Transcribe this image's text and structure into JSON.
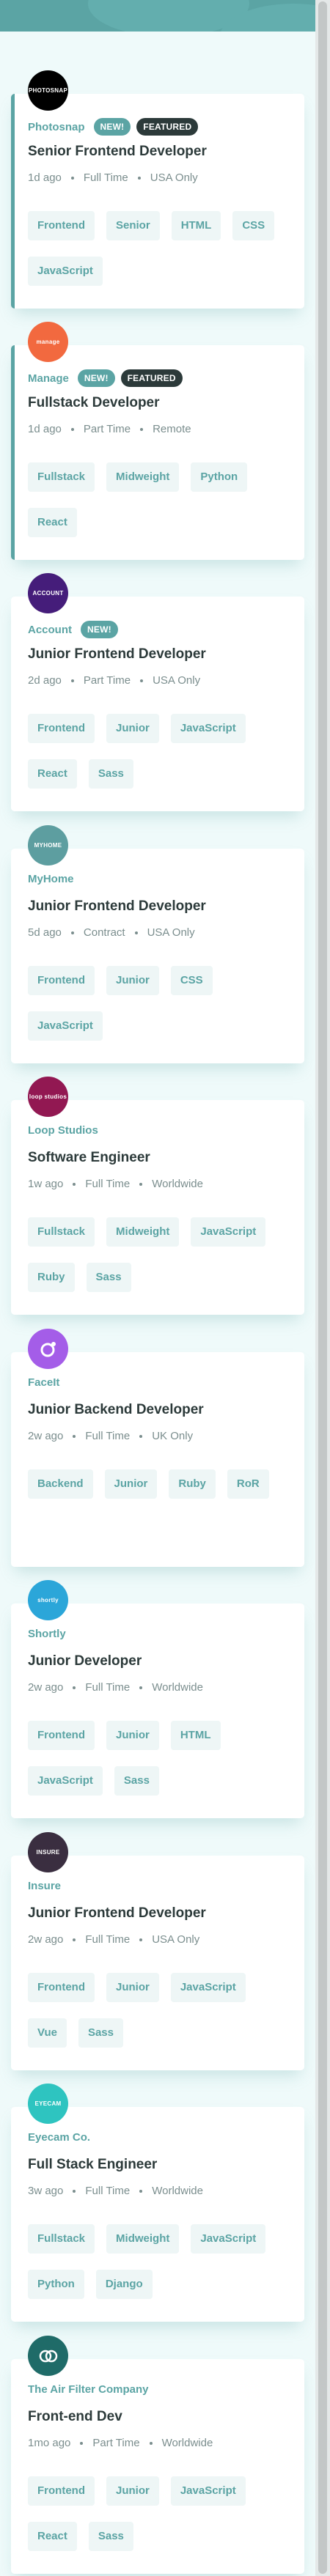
{
  "colors": {
    "accent": "#5ba4a4",
    "dark": "#2c3a3a",
    "muted": "#7b8e8e",
    "tag_bg": "#eef6f6",
    "background": "#effafa"
  },
  "badges": {
    "new": "NEW!",
    "featured": "FEATURED"
  },
  "jobs": [
    {
      "company": "Photosnap",
      "logo_text": "PHOTOSNAP",
      "logo_color": "#000000",
      "logo_icon": "photosnap-logo-icon",
      "new": true,
      "featured": true,
      "position": "Senior Frontend Developer",
      "posted": "1d ago",
      "contract": "Full Time",
      "location": "USA Only",
      "tags": [
        "Frontend",
        "Senior",
        "HTML",
        "CSS",
        "JavaScript"
      ]
    },
    {
      "company": "Manage",
      "logo_text": "manage",
      "logo_color": "#f2693f",
      "logo_icon": "manage-logo-icon",
      "new": true,
      "featured": true,
      "position": "Fullstack Developer",
      "posted": "1d ago",
      "contract": "Part Time",
      "location": "Remote",
      "tags": [
        "Fullstack",
        "Midweight",
        "Python",
        "React"
      ]
    },
    {
      "company": "Account",
      "logo_text": "ACCOUNT",
      "logo_color": "#451d7a",
      "logo_icon": "account-logo-icon",
      "new": true,
      "featured": false,
      "position": "Junior Frontend Developer",
      "posted": "2d ago",
      "contract": "Part Time",
      "location": "USA Only",
      "tags": [
        "Frontend",
        "Junior",
        "JavaScript",
        "React",
        "Sass"
      ]
    },
    {
      "company": "MyHome",
      "logo_text": "MYHOME",
      "logo_color": "#5d9ea0",
      "logo_icon": "myhome-logo-icon",
      "new": false,
      "featured": false,
      "position": "Junior Frontend Developer",
      "posted": "5d ago",
      "contract": "Contract",
      "location": "USA Only",
      "tags": [
        "Frontend",
        "Junior",
        "CSS",
        "JavaScript"
      ]
    },
    {
      "company": "Loop Studios",
      "logo_text": "loop studios",
      "logo_color": "#921852",
      "logo_icon": "loop-studios-logo-icon",
      "new": false,
      "featured": false,
      "position": "Software Engineer",
      "posted": "1w ago",
      "contract": "Full Time",
      "location": "Worldwide",
      "tags": [
        "Fullstack",
        "Midweight",
        "JavaScript",
        "Ruby",
        "Sass"
      ]
    },
    {
      "company": "FaceIt",
      "logo_text": "O",
      "logo_color": "#a45de8",
      "logo_icon": "faceit-logo-icon",
      "new": false,
      "featured": false,
      "position": "Junior Backend Developer",
      "posted": "2w ago",
      "contract": "Full Time",
      "location": "UK Only",
      "tags": [
        "Backend",
        "Junior",
        "Ruby",
        "RoR"
      ]
    },
    {
      "company": "Shortly",
      "logo_text": "shortly",
      "logo_color": "#2ba6d9",
      "logo_icon": "shortly-logo-icon",
      "new": false,
      "featured": false,
      "position": "Junior Developer",
      "posted": "2w ago",
      "contract": "Full Time",
      "location": "Worldwide",
      "tags": [
        "Frontend",
        "Junior",
        "HTML",
        "JavaScript",
        "Sass"
      ]
    },
    {
      "company": "Insure",
      "logo_text": "INSURE",
      "logo_color": "#3a2e40",
      "logo_icon": "insure-logo-icon",
      "new": false,
      "featured": false,
      "position": "Junior Frontend Developer",
      "posted": "2w ago",
      "contract": "Full Time",
      "location": "USA Only",
      "tags": [
        "Frontend",
        "Junior",
        "JavaScript",
        "Vue",
        "Sass"
      ]
    },
    {
      "company": "Eyecam Co.",
      "logo_text": "EYECAM",
      "logo_color": "#2ec4c0",
      "logo_icon": "eyecam-logo-icon",
      "new": false,
      "featured": false,
      "position": "Full Stack Engineer",
      "posted": "3w ago",
      "contract": "Full Time",
      "location": "Worldwide",
      "tags": [
        "Fullstack",
        "Midweight",
        "JavaScript",
        "Python",
        "Django"
      ]
    },
    {
      "company": "The Air Filter Company",
      "logo_text": "",
      "logo_color": "#1f6b68",
      "logo_icon": "air-filter-logo-icon",
      "new": false,
      "featured": false,
      "position": "Front-end Dev",
      "posted": "1mo ago",
      "contract": "Part Time",
      "location": "Worldwide",
      "tags": [
        "Frontend",
        "Junior",
        "JavaScript",
        "React",
        "Sass"
      ]
    }
  ]
}
